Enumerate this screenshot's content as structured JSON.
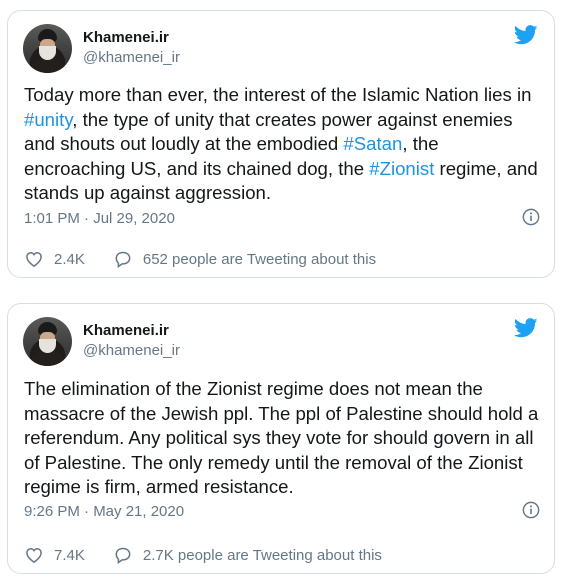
{
  "tweets": [
    {
      "display_name": "Khamenei.ir",
      "handle": "@khamenei_ir",
      "text_parts": {
        "p1": "Today more than ever, the interest of the Islamic Nation lies in ",
        "h1": "#unity",
        "p2": ", the type of unity that creates power against enemies and shouts out loudly at the embodied ",
        "h2": "#Satan",
        "p3": ", the encroaching US, and its chained dog, the ",
        "h3": "#Zionist",
        "p4": " regime, and stands up against aggression."
      },
      "timestamp": "1:01 PM · Jul 29, 2020",
      "likes": "2.4K",
      "tweeting": "652 people are Tweeting about this"
    },
    {
      "display_name": "Khamenei.ir",
      "handle": "@khamenei_ir",
      "text": "The elimination of the Zionist regime does not mean the massacre of the Jewish ppl. The ppl of Palestine should hold a referendum. Any political sys they vote for should govern in all of Palestine. The only remedy until the removal of the Zionist regime is firm, armed resistance.",
      "timestamp": "9:26 PM · May 21, 2020",
      "likes": "7.4K",
      "tweeting": "2.7K people are Tweeting about this"
    }
  ],
  "colors": {
    "text": "#14171a",
    "secondary": "#657786",
    "link": "#1b95e0",
    "twitter_blue": "#1da1f2",
    "border": "#d6dee3"
  },
  "icons": {
    "brand": "twitter-bird-icon",
    "info": "info-icon",
    "like": "heart-icon",
    "reply": "speech-bubble-icon"
  }
}
